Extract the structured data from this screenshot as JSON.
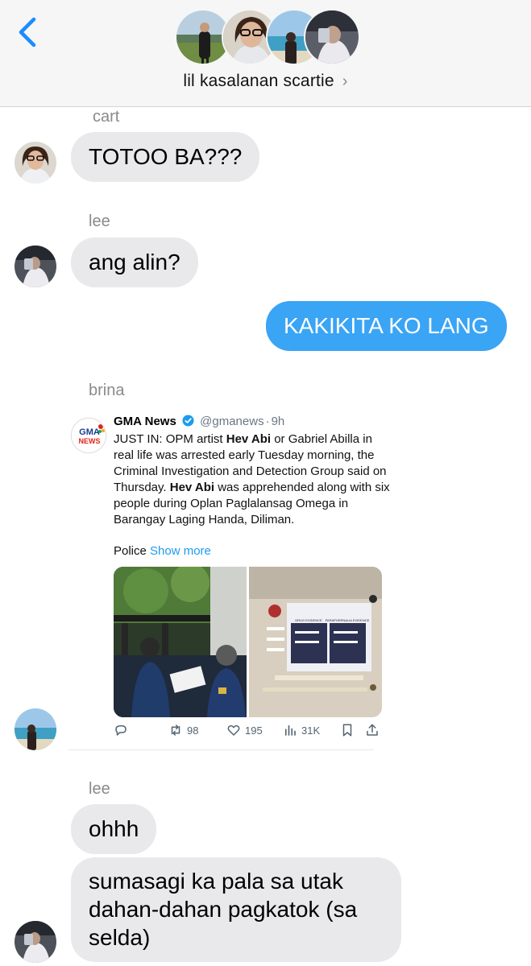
{
  "header": {
    "back_icon": "chevron-left-icon",
    "group_name": "lil kasalanan scartie",
    "chevron": "›",
    "accent_color": "#1a8cff"
  },
  "messages": [
    {
      "sender": "cart",
      "text": "TOTOO BA???",
      "direction": "incoming"
    },
    {
      "sender": "lee",
      "text": "ang alin?",
      "direction": "incoming"
    },
    {
      "text": "KAKIKITA KO LANG",
      "direction": "outgoing",
      "color": "#3aa4f5"
    },
    {
      "sender": "brina",
      "type": "tweet-share",
      "direction": "incoming"
    },
    {
      "sender": "lee",
      "text": "ohhh",
      "direction": "incoming"
    },
    {
      "text_lines": [
        "sumasagi ka pala sa utak",
        "dahan-dahan pagkatok (sa",
        "selda)"
      ],
      "direction": "incoming"
    }
  ],
  "tweet": {
    "name": "GMA News",
    "verified_icon": "verified-badge-icon",
    "handle": "@gmanews",
    "separator": "·",
    "time": "9h",
    "body_1": "JUST IN: OPM artist ",
    "bold_1": "Hev Abi",
    "body_2": " or Gabriel Abilla in real life was arrested early Tuesday morning, the Criminal Investigation and Detection Group said on Thursday. ",
    "bold_2": "Hev Abi",
    "body_3": " was apprehended along with six people during Oplan Paglalansag Omega in Barangay Laging Handa, Diliman.",
    "more_prefix": "Police",
    "show_more": "Show more",
    "logo_text_1": "GMA",
    "logo_text_2": "NEWS",
    "evidence_labels": [
      "DRUG EVIDENCE",
      "PARAPHERNALIA EVIDENCE"
    ],
    "actions": {
      "reply_icon": "reply-icon",
      "retweets": "98",
      "likes": "195",
      "views": "31K",
      "bookmark_icon": "bookmark-icon",
      "share_icon": "share-icon"
    }
  }
}
